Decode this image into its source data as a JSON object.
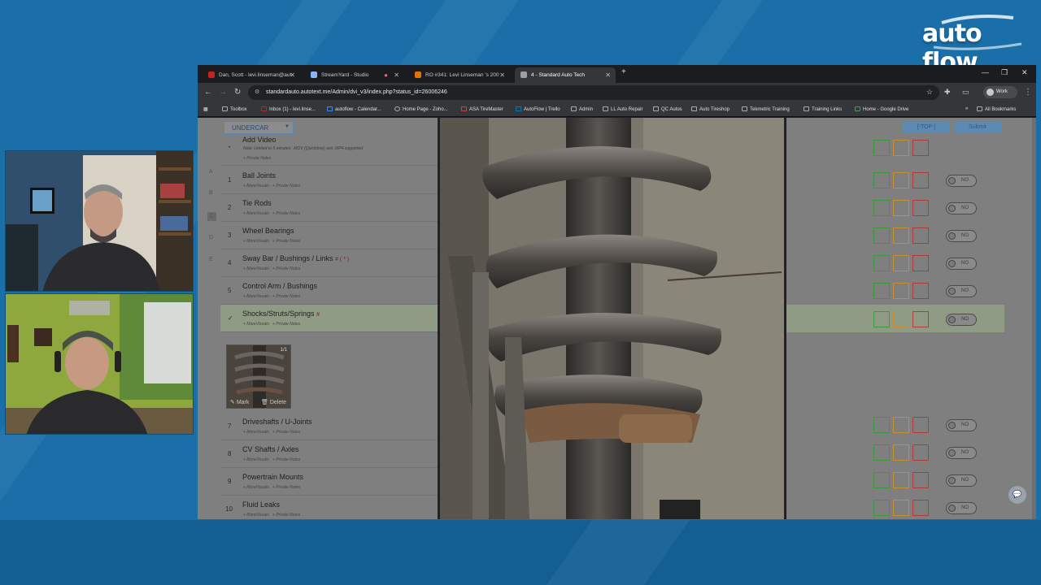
{
  "brand": {
    "logo_text": "auto flow"
  },
  "browser": {
    "tabs": [
      {
        "label": "Dan, Scott - levi.linseman@aut",
        "favicon_color": "#c5221f"
      },
      {
        "label": "StreamYard - Studio",
        "favicon_color": "#8ab4f8"
      },
      {
        "label": "RO #341: Levi Linseman 's 200",
        "favicon_color": "#e37400"
      },
      {
        "label": "4 - Standard Auto Tech",
        "favicon_color": "#9aa0a6"
      }
    ],
    "new_tab_label": "+",
    "url": "standardauto.autotext.me/Admin/dvi_v3/index.php?status_id=26006246",
    "profile_label": "Work",
    "bookmarks": [
      "Toolbox",
      "Inbox (1) - levi.linse...",
      "autoflow - Calendar...",
      "Home Page - Zoho...",
      "ASA TireMaster",
      "AutoFlow | Trello",
      "Admin",
      "LL Auto Repair",
      "QC Autos",
      "Auto Tireshop",
      "Tekmetric Training",
      "Training Links",
      "Home - Google Drive"
    ],
    "all_bookmarks_label": "All Bookmarks"
  },
  "inspection": {
    "category": "UNDERCAR",
    "letters": [
      "A",
      "B",
      "C",
      "D",
      "E"
    ],
    "add_video": {
      "title": "Add Video",
      "note": "Note: Limited to 5 minutes; .MOV (Quicktime) and .MP4 supported",
      "private_notes": "+ Private Notes"
    },
    "items": [
      {
        "num": "1",
        "title": "Ball Joints",
        "flag": "",
        "sub_visuals": "+ MoreVisuals",
        "sub_notes": "+ Private Notes"
      },
      {
        "num": "2",
        "title": "Tie Rods",
        "flag": "",
        "sub_visuals": "+ MoreVisuals",
        "sub_notes": "+ Private Notes"
      },
      {
        "num": "3",
        "title": "Wheel Bearings",
        "flag": "",
        "sub_visuals": "+ MoreVisuals",
        "sub_notes": "+ Private Notes"
      },
      {
        "num": "4",
        "title": "Sway Bar / Bushings / Links",
        "flag": "# ( * )",
        "sub_visuals": "+ MoreVisuals",
        "sub_notes": "+ Private Notes"
      },
      {
        "num": "5",
        "title": "Control Arm / Bushings",
        "flag": "",
        "sub_visuals": "+ MoreVisuals",
        "sub_notes": "+ Private Notes"
      },
      {
        "num": "✓",
        "title": "Shocks/Struts/Springs",
        "flag": "#",
        "sub_visuals": "+ MoreVisuals",
        "sub_notes": "+ Private Notes"
      },
      {
        "num": "7",
        "title": "Driveshafts / U-Joints",
        "flag": "",
        "sub_visuals": "+ MoreVisuals",
        "sub_notes": "+ Private Notes"
      },
      {
        "num": "8",
        "title": "CV Shafts / Axles",
        "flag": "",
        "sub_visuals": "+ MoreVisuals",
        "sub_notes": "+ Private Notes"
      },
      {
        "num": "9",
        "title": "Powertrain Mounts",
        "flag": "",
        "sub_visuals": "+ MoreVisuals",
        "sub_notes": "+ Private Notes"
      },
      {
        "num": "10",
        "title": "Fluid Leaks",
        "flag": "",
        "sub_visuals": "+ MoreVisuals",
        "sub_notes": "+ Private Notes"
      }
    ],
    "thumbnail": {
      "count": "1/1",
      "mark_label": "Mark",
      "delete_label": "Delete"
    },
    "top_button": "[-TOP-]",
    "submit_button": "Submit",
    "toggle_label": "NO"
  },
  "colors": {
    "good": "#3c9a3c",
    "warn": "#c98e2c",
    "bad": "#b23a3a",
    "accent": "#5c8ab3"
  }
}
